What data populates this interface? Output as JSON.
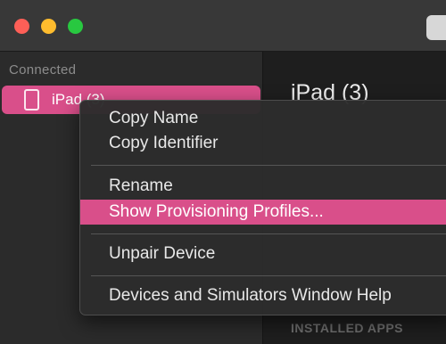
{
  "sidebar": {
    "section_header": "Connected",
    "devices": [
      {
        "label": "iPad (3)",
        "icon": "ipad-icon",
        "selected": true
      }
    ]
  },
  "detail": {
    "title": "iPad (3)",
    "installed_apps_header": "INSTALLED APPS"
  },
  "context_menu": {
    "items": [
      {
        "label": "Copy Name"
      },
      {
        "label": "Copy Identifier"
      },
      {
        "label": "Rename"
      },
      {
        "label": "Show Provisioning Profiles...",
        "highlighted": true
      },
      {
        "label": "Unpair Device"
      },
      {
        "label": "Devices and Simulators Window Help"
      }
    ]
  },
  "colors": {
    "accent": "#d94f8a",
    "close": "#fe5f57",
    "minimize": "#febc2e",
    "zoom": "#28c840"
  }
}
